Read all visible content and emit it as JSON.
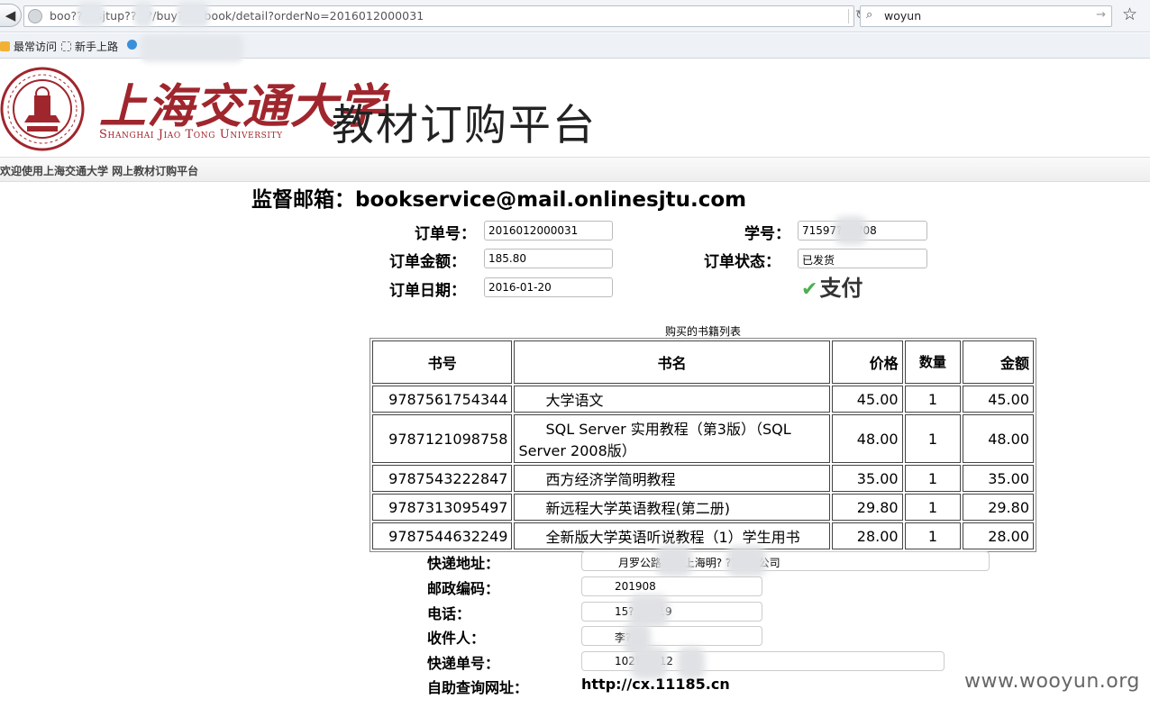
{
  "browser": {
    "url": "boo?? ?.sjtup?? ??/buy? ? ebook/detail?orderNo=2016012000031",
    "search_value": "woyun",
    "bookmarks": [
      "最常访问",
      "新手上路"
    ]
  },
  "header": {
    "university_cn": "上海交通大学",
    "university_en": "Shanghai Jiao Tong University",
    "platform_title": "教材订购平台",
    "welcome": "欢迎使用上海交通大学 网上教材订购平台"
  },
  "supervise": "监督邮箱：bookservice@mail.onlinesjtu.com",
  "order": {
    "order_no_label": "订单号：",
    "order_no": "2016012000031",
    "student_no_label": "学号：",
    "student_no": "71597?? ??08",
    "amount_label": "订单金额：",
    "amount": "185.80",
    "status_label": "订单状态：",
    "status": "已发货",
    "date_label": "订单日期：",
    "date": "2016-01-20",
    "pay_label": "支付"
  },
  "book_table": {
    "caption": "购买的书籍列表",
    "headers": [
      "书号",
      "书名",
      "价格",
      "数量",
      "金额"
    ],
    "rows": [
      [
        "9787561754344",
        "大学语文",
        "45.00",
        "1",
        "45.00"
      ],
      [
        "9787121098758",
        "SQL Server 实用教程（第3版）（SQL Server 2008版）",
        "48.00",
        "1",
        "48.00"
      ],
      [
        "9787543222847",
        "西方经济学简明教程",
        "35.00",
        "1",
        "35.00"
      ],
      [
        "9787313095497",
        "新远程大学英语教程(第二册)",
        "29.80",
        "1",
        "29.80"
      ],
      [
        "9787544632249",
        "全新版大学英语听说教程（1）学生用书",
        "28.00",
        "1",
        "28.00"
      ]
    ]
  },
  "delivery": {
    "address_label": "快递地址：",
    "address": "月罗公路??号上海明? ??有限公司",
    "zip_label": "邮政编码：",
    "zip": "201908",
    "phone_label": "电话：",
    "phone": "15? ? ??19",
    "receiver_label": "收件人：",
    "receiver": "李?",
    "tracking_label": "快递单号：",
    "tracking": "102? ? ?12",
    "query_label": "自助查询网址：",
    "query_url": "http://cx.11185.cn"
  },
  "watermark": "www.wooyun.org"
}
